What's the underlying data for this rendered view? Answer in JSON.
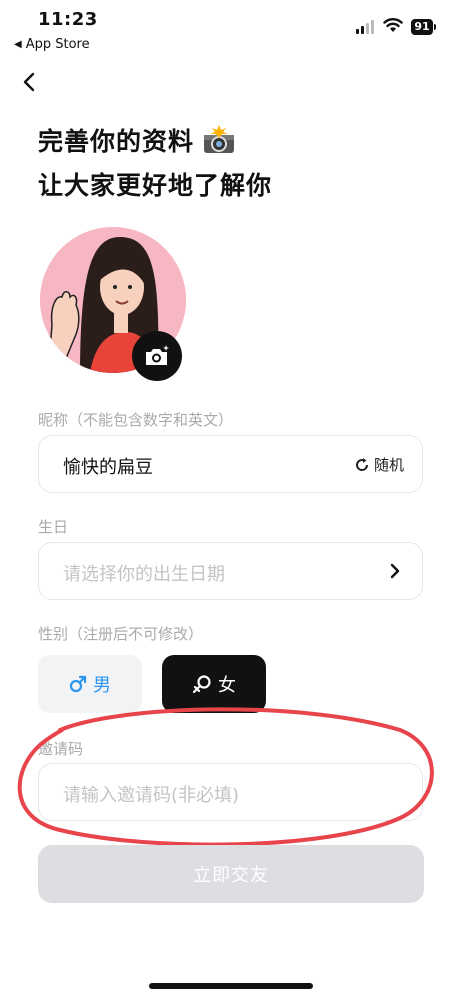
{
  "status_bar": {
    "time": "11:23",
    "back_app": "App Store",
    "battery": "91"
  },
  "header": {
    "line1": "完善你的资料",
    "line2": "让大家更好地了解你",
    "emoji_icon": "camera-flash-icon"
  },
  "form": {
    "nickname": {
      "label": "昵称（不能包含数字和英文）",
      "value": "愉快的扁豆",
      "random_label": "随机"
    },
    "birthday": {
      "label": "生日",
      "placeholder": "请选择你的出生日期"
    },
    "gender": {
      "label": "性别（注册后不可修改）",
      "male": "男",
      "female": "女",
      "selected": "女"
    },
    "invite": {
      "label": "邀请码",
      "placeholder": "请输入邀请码(非必填)"
    }
  },
  "submit_label": "立即交友",
  "colors": {
    "accent_male": "#2b95f0",
    "selected_bg": "#111111",
    "annotation": "#e8444b",
    "submit_disabled": "#dcdee2"
  }
}
